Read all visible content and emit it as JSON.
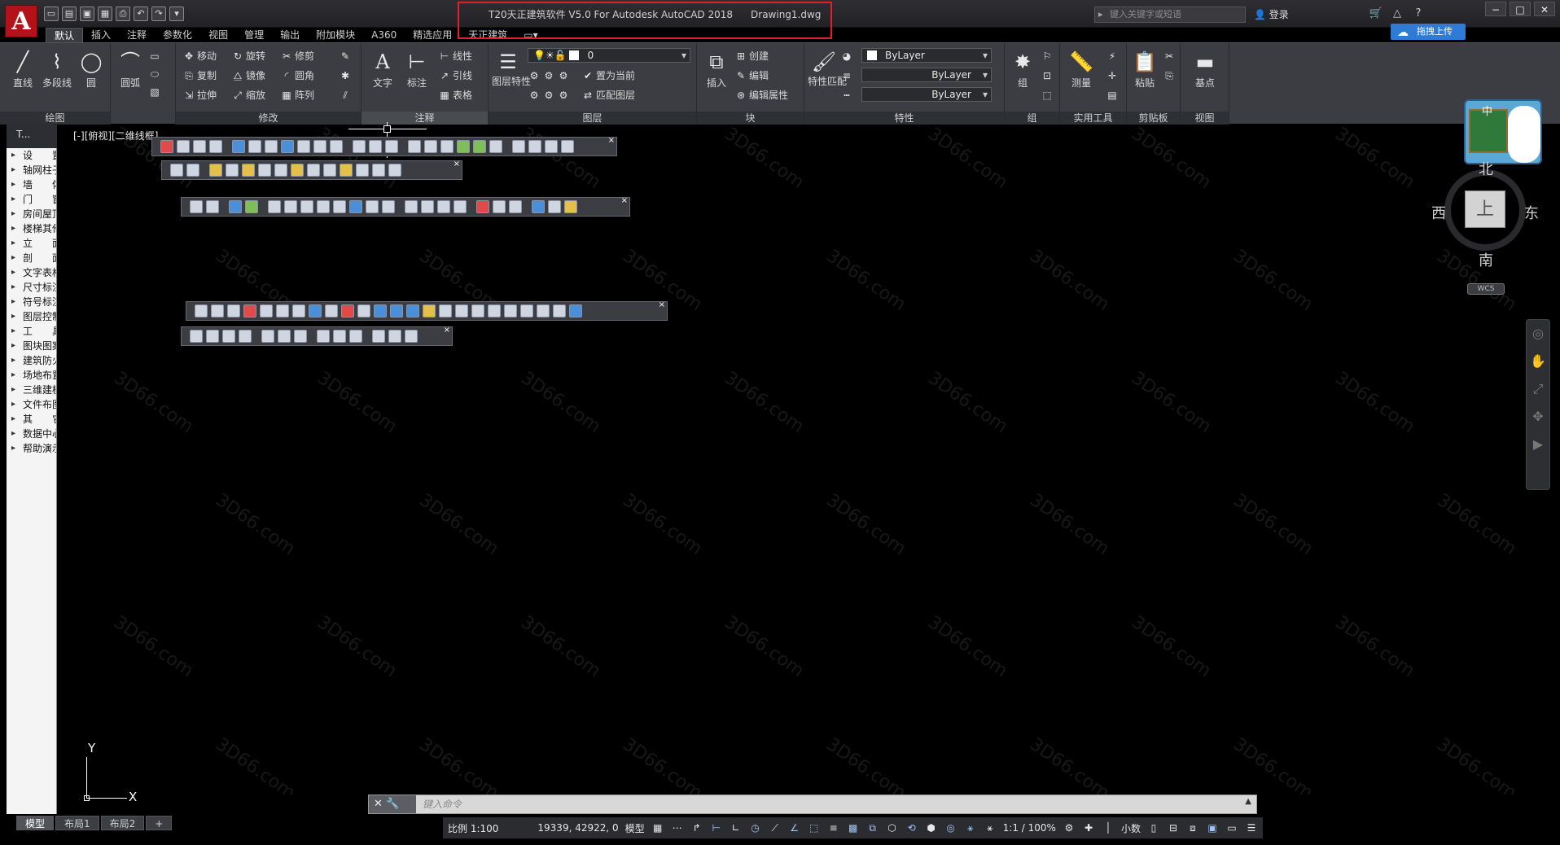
{
  "app": {
    "logo": "A",
    "title": "T20天正建筑软件 V5.0 For Autodesk AutoCAD 2018",
    "document": "Drawing1.dwg",
    "search_placeholder": "键入关键字或短语",
    "signin": "登录",
    "upload": "拖拽上传"
  },
  "ribbon_tabs": [
    "默认",
    "插入",
    "注释",
    "参数化",
    "视图",
    "管理",
    "输出",
    "附加模块",
    "A360",
    "精选应用",
    "天正建筑"
  ],
  "panels": {
    "draw": {
      "title": "绘图",
      "line": "直线",
      "polyline": "多段线",
      "circle": "圆",
      "arc": "圆弧"
    },
    "modify": {
      "title": "修改",
      "move": "移动",
      "rotate": "旋转",
      "trim": "修剪",
      "copy": "复制",
      "mirror": "镜像",
      "fillet": "圆角",
      "stretch": "拉伸",
      "scale": "缩放",
      "array": "阵列"
    },
    "annotation": {
      "title": "注释",
      "text": "文字",
      "dimension": "标注",
      "linear": "线性",
      "leader": "引线",
      "table": "表格"
    },
    "layers": {
      "title": "图层",
      "layer_props": "图层特性",
      "current_layer": "0",
      "make_current": "置为当前",
      "match_layer": "匹配图层"
    },
    "block": {
      "title": "块",
      "insert": "插入",
      "create": "创建",
      "edit": "编辑",
      "edit_attr": "编辑属性"
    },
    "properties": {
      "title": "特性",
      "match": "特性匹配",
      "color": "ByLayer",
      "linetype": "ByLayer",
      "lineweight": "ByLayer"
    },
    "groups": {
      "title": "组",
      "group": "组"
    },
    "utilities": {
      "title": "实用工具",
      "measure": "测量"
    },
    "clipboard": {
      "title": "剪贴板",
      "paste": "粘贴"
    },
    "view": {
      "title": "视图",
      "base": "基点"
    }
  },
  "palette": {
    "header": "T...",
    "items": [
      "设　　置",
      "轴网柱子",
      "墙　　体",
      "门　　窗",
      "房间屋顶",
      "楼梯其他",
      "立　　面",
      "剖　　面",
      "文字表格",
      "尺寸标注",
      "符号标注",
      "图层控制",
      "工　　具",
      "图块图案",
      "建筑防火",
      "场地布置",
      "三维建模",
      "文件布图",
      "其　　它",
      "数据中心",
      "帮助演示"
    ]
  },
  "viewport_label": "[-][俯视][二维线框]",
  "ucs": {
    "x": "X",
    "y": "Y"
  },
  "viewcube": {
    "north": "北",
    "south": "南",
    "east": "东",
    "west": "西",
    "face": "上",
    "wcs": "WCS"
  },
  "mascot_text": "中",
  "command": {
    "placeholder": "键入命令"
  },
  "layout_tabs": [
    "模型",
    "布局1",
    "布局2",
    "+"
  ],
  "status": {
    "scale": "比例 1:100",
    "coords": "19339, 42922, 0",
    "model": "模型",
    "annotation_scale": "1:1 / 100%",
    "units": "小数"
  },
  "watermark": "3D66.com",
  "colors": {
    "accent": "#2e7bd6",
    "logo": "#b3121b",
    "highlight": "#e0202a",
    "canvas": "#000000",
    "ribbon": "#3b3d42"
  }
}
